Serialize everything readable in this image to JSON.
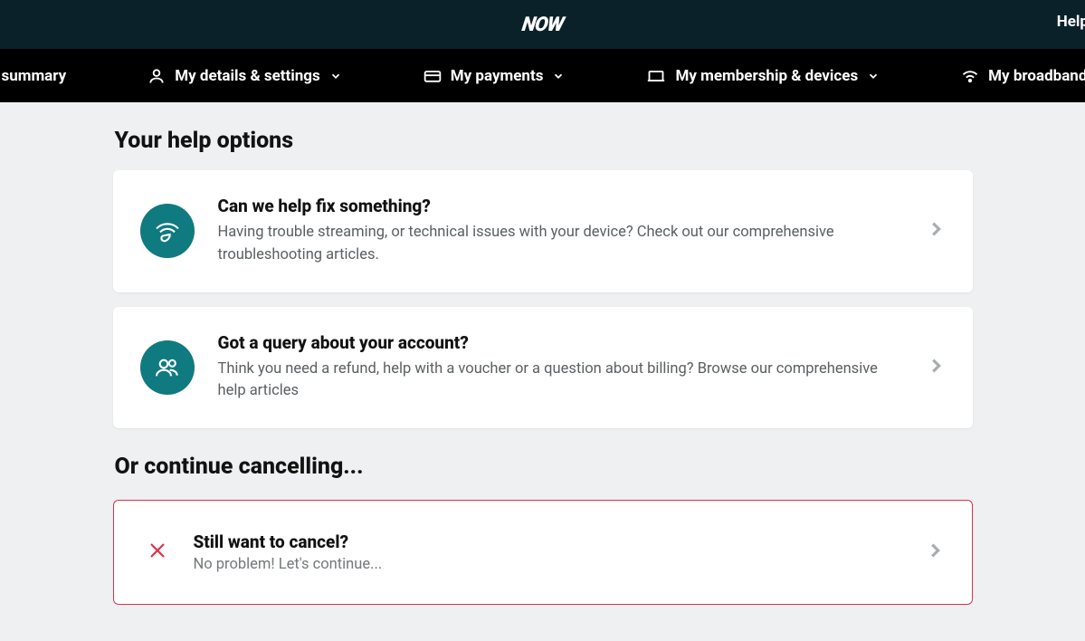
{
  "header": {
    "logo": "NOW",
    "help_link": "Help"
  },
  "nav": {
    "account_summary": "count summary",
    "details": "My details & settings",
    "payments": "My payments",
    "membership": "My membership & devices",
    "broadband": "My broadband & ca"
  },
  "main": {
    "help_heading": "Your help options",
    "card1": {
      "title": "Can we help fix something?",
      "desc": "Having trouble streaming, or technical issues with your device? Check out our comprehensive troubleshooting articles."
    },
    "card2": {
      "title": "Got a query about your account?",
      "desc": "Think you need a refund, help with a voucher or a question about billing? Browse our comprehensive help articles"
    },
    "cancel_heading": "Or continue cancelling...",
    "cancel_card": {
      "title": "Still want to cancel?",
      "desc": "No problem! Let's continue..."
    }
  }
}
